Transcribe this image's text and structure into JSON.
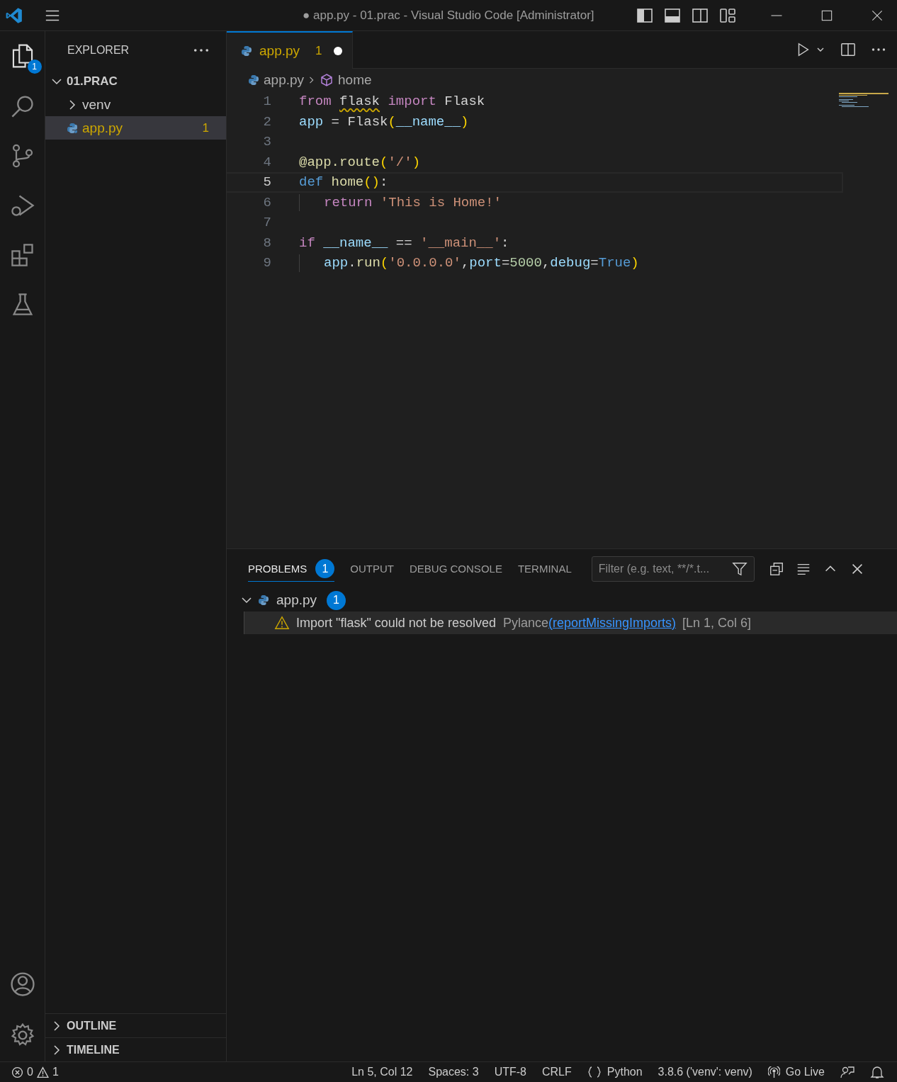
{
  "window": {
    "title": "● app.py - 01.prac - Visual Studio Code [Administrator]"
  },
  "activity_bar": {
    "explorer_badge": "1"
  },
  "sidebar": {
    "title": "EXPLORER",
    "tree": [
      {
        "label": "01.PRAC",
        "kind": "folder",
        "expanded": true,
        "selected": false,
        "children": [
          {
            "label": "venv",
            "kind": "folder",
            "expanded": false,
            "selected": false
          },
          {
            "label": "app.py",
            "kind": "file",
            "selected": true,
            "problems": "1"
          }
        ]
      }
    ],
    "sections": [
      {
        "label": "OUTLINE",
        "expanded": false
      },
      {
        "label": "TIMELINE",
        "expanded": false
      }
    ]
  },
  "editor": {
    "tabs": [
      {
        "label": "app.py",
        "problems": "1",
        "modified": true,
        "selected": true
      }
    ],
    "breadcrumb": [
      "app.py",
      "home"
    ],
    "lines": [
      {
        "number": "1",
        "current": false,
        "indent": false,
        "tokens": [
          {
            "text": "from ",
            "kind": "keyword"
          },
          {
            "text": "flask",
            "kind": "unresolved"
          },
          {
            "text": " import ",
            "kind": "keyword"
          },
          {
            "text": "Flask",
            "kind": "plain"
          }
        ]
      },
      {
        "number": "2",
        "current": false,
        "indent": false,
        "tokens": [
          {
            "text": "app",
            "kind": "variable"
          },
          {
            "text": " = Flask",
            "kind": "plain"
          },
          {
            "text": "(",
            "kind": "bracket"
          },
          {
            "text": "__name__",
            "kind": "variable"
          },
          {
            "text": ")",
            "kind": "bracket"
          }
        ]
      },
      {
        "number": "3",
        "current": false,
        "indent": false
      },
      {
        "number": "4",
        "current": false,
        "indent": false,
        "tokens": [
          {
            "text": "@app.route",
            "kind": "function"
          },
          {
            "text": "(",
            "kind": "bracket"
          },
          {
            "text": "'/'",
            "kind": "string"
          },
          {
            "text": ")",
            "kind": "bracket"
          }
        ]
      },
      {
        "number": "5",
        "current": true,
        "indent": false,
        "tokens": [
          {
            "text": "def ",
            "kind": "storage"
          },
          {
            "text": "home",
            "kind": "function"
          },
          {
            "text": "()",
            "kind": "bracket"
          },
          {
            "text": ":",
            "kind": "plain"
          }
        ]
      },
      {
        "number": "6",
        "current": false,
        "indent": true,
        "tokens": [
          {
            "text": "return ",
            "kind": "keyword"
          },
          {
            "text": "'This is Home!'",
            "kind": "string"
          }
        ]
      },
      {
        "number": "7",
        "current": false,
        "indent": false
      },
      {
        "number": "8",
        "current": false,
        "indent": false,
        "tokens": [
          {
            "text": "if ",
            "kind": "keyword"
          },
          {
            "text": "__name__",
            "kind": "variable"
          },
          {
            "text": " == ",
            "kind": "plain"
          },
          {
            "text": "'__main__'",
            "kind": "string"
          },
          {
            "text": ":",
            "kind": "plain"
          }
        ]
      },
      {
        "number": "9",
        "current": false,
        "indent": true,
        "tokens": [
          {
            "text": "app",
            "kind": "variable"
          },
          {
            "text": ".",
            "kind": "plain"
          },
          {
            "text": "run",
            "kind": "function"
          },
          {
            "text": "(",
            "kind": "bracket"
          },
          {
            "text": "'0.0.0.0'",
            "kind": "string"
          },
          {
            "text": ",",
            "kind": "plain"
          },
          {
            "text": "port",
            "kind": "variable"
          },
          {
            "text": "=",
            "kind": "plain"
          },
          {
            "text": "5000",
            "kind": "number"
          },
          {
            "text": ",",
            "kind": "plain"
          },
          {
            "text": "debug",
            "kind": "variable"
          },
          {
            "text": "=",
            "kind": "plain"
          },
          {
            "text": "True",
            "kind": "storage"
          },
          {
            "text": ")",
            "kind": "bracket"
          }
        ]
      }
    ]
  },
  "panel": {
    "tabs": [
      {
        "label": "PROBLEMS",
        "badge": "1",
        "selected": true
      },
      {
        "label": "OUTPUT",
        "selected": false
      },
      {
        "label": "DEBUG CONSOLE",
        "selected": false
      },
      {
        "label": "TERMINAL",
        "selected": false
      }
    ],
    "filter": {
      "placeholder": "Filter (e.g. text, **/*.t..."
    },
    "problem_files": [
      {
        "file": "app.py",
        "count": "1",
        "expanded": true,
        "problems": [
          {
            "message": "Import \"flask\" could not be resolved",
            "source": "Pylance",
            "code": "(reportMissingImports)",
            "location": "[Ln 1, Col 6]"
          }
        ]
      }
    ]
  },
  "status_bar": {
    "errors": "0",
    "warnings": "1",
    "position": "Ln 5, Col 12",
    "spaces": "Spaces: 3",
    "encoding": "UTF-8",
    "eol": "CRLF",
    "language": "Python",
    "interpreter": "3.8.6 ('venv': venv)",
    "live": "Go Live"
  }
}
